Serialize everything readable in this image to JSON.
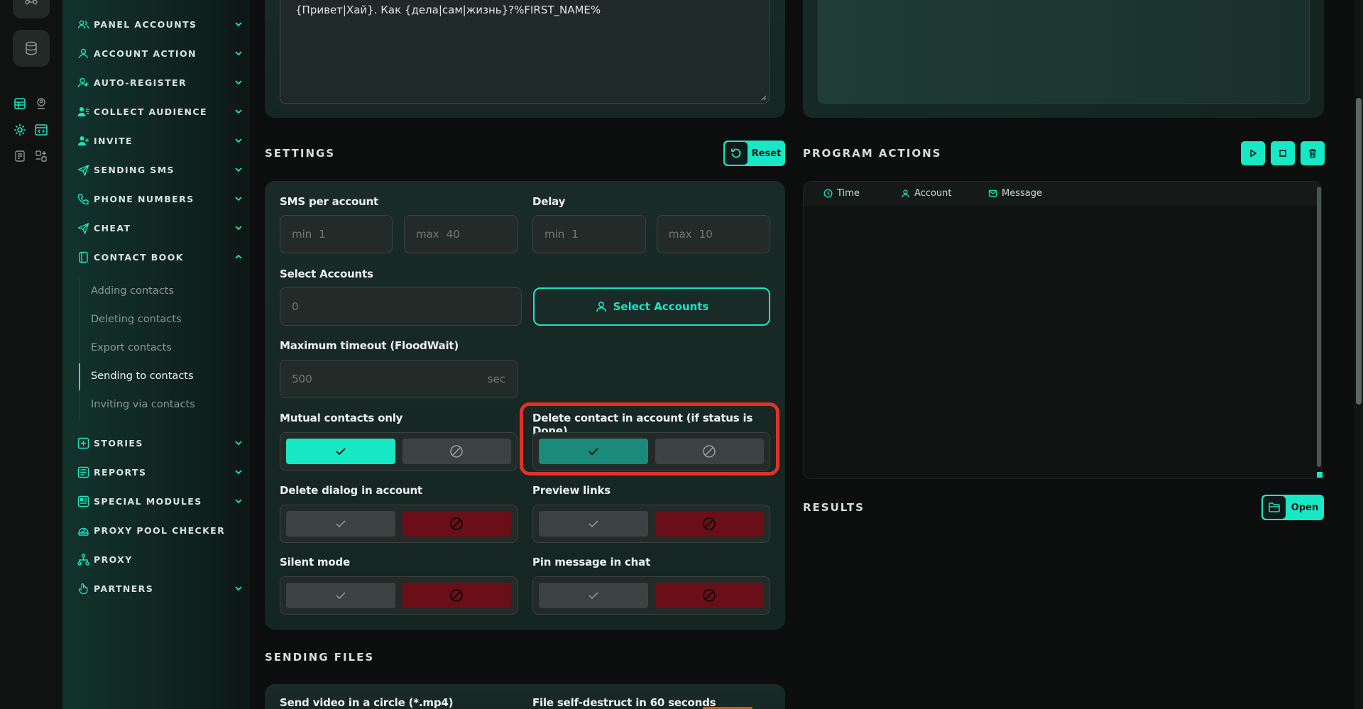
{
  "sidebar": {
    "items": [
      {
        "label": "PANEL ACCOUNTS",
        "icon": "users-icon",
        "expanded": false
      },
      {
        "label": "ACCOUNT ACTION",
        "icon": "user-icon",
        "expanded": false
      },
      {
        "label": "AUTO-REGISTER",
        "icon": "user-plus-icon",
        "expanded": false
      },
      {
        "label": "COLLECT AUDIENCE",
        "icon": "user-list-icon",
        "expanded": false
      },
      {
        "label": "INVITE",
        "icon": "user-add-icon",
        "expanded": false
      },
      {
        "label": "SENDING SMS",
        "icon": "send-icon",
        "expanded": false
      },
      {
        "label": "PHONE NUMBERS",
        "icon": "phone-icon",
        "expanded": false
      },
      {
        "label": "CHEAT",
        "icon": "send-icon",
        "expanded": false
      },
      {
        "label": "CONTACT BOOK",
        "icon": "book-icon",
        "expanded": true
      },
      {
        "label": "STORIES",
        "icon": "plus-square-icon",
        "expanded": false
      },
      {
        "label": "REPORTS",
        "icon": "report-icon",
        "expanded": false
      },
      {
        "label": "SPECIAL MODULES",
        "icon": "modules-icon",
        "expanded": false
      },
      {
        "label": "PROXY POOL CHECKER",
        "icon": "proxy-check-icon"
      },
      {
        "label": "PROXY",
        "icon": "network-icon"
      },
      {
        "label": "PARTNERS",
        "icon": "hand-icon",
        "expanded": false
      }
    ],
    "contact_book_subitems": [
      {
        "label": "Adding contacts",
        "active": false
      },
      {
        "label": "Deleting contacts",
        "active": false
      },
      {
        "label": "Export contacts",
        "active": false
      },
      {
        "label": "Sending to contacts",
        "active": true
      },
      {
        "label": "Inviting via contacts",
        "active": false
      }
    ]
  },
  "message": {
    "text": "{Привет|Хай}. Как {дела|сам|жизнь}?%FIRST_NAME%"
  },
  "settings": {
    "title": "SETTINGS",
    "reset_label": "Reset",
    "sms_per_account": {
      "label": "SMS per account",
      "min_prefix": "min",
      "min_value": "1",
      "max_prefix": "max",
      "max_value": "40"
    },
    "delay": {
      "label": "Delay",
      "min_prefix": "min",
      "min_value": "1",
      "max_prefix": "max",
      "max_value": "10"
    },
    "select_accounts": {
      "label": "Select Accounts",
      "count": "0",
      "button_label": "Select Accounts"
    },
    "max_timeout": {
      "label": "Maximum timeout (FloodWait)",
      "value": "500",
      "unit": "sec"
    },
    "mutual_contacts_only": {
      "label": "Mutual contacts only",
      "enabled": true
    },
    "delete_contact": {
      "label": "Delete contact in account (if status is Done)",
      "enabled": true
    },
    "delete_dialog": {
      "label": "Delete dialog in account",
      "enabled": false
    },
    "preview_links": {
      "label": "Preview links",
      "enabled": false
    },
    "silent_mode": {
      "label": "Silent mode",
      "enabled": false
    },
    "pin_message": {
      "label": "Pin message in chat",
      "enabled": false
    }
  },
  "sending_files": {
    "title": "SENDING FILES",
    "video_circle_label": "Send video in a circle (*.mp4)",
    "self_destruct_label": "File self-destruct in 60 seconds"
  },
  "program_actions": {
    "title": "PROGRAM ACTIONS",
    "columns": [
      {
        "label": "Time",
        "icon": "clock-icon"
      },
      {
        "label": "Account",
        "icon": "user-icon"
      },
      {
        "label": "Message",
        "icon": "mail-icon"
      }
    ]
  },
  "results": {
    "title": "RESULTS",
    "open_label": "Open"
  },
  "colors": {
    "accent": "#17e8c5",
    "enabled_dim": "#1a8a7a",
    "disabled_red": "#6a0e18",
    "highlight": "#e2302a"
  }
}
